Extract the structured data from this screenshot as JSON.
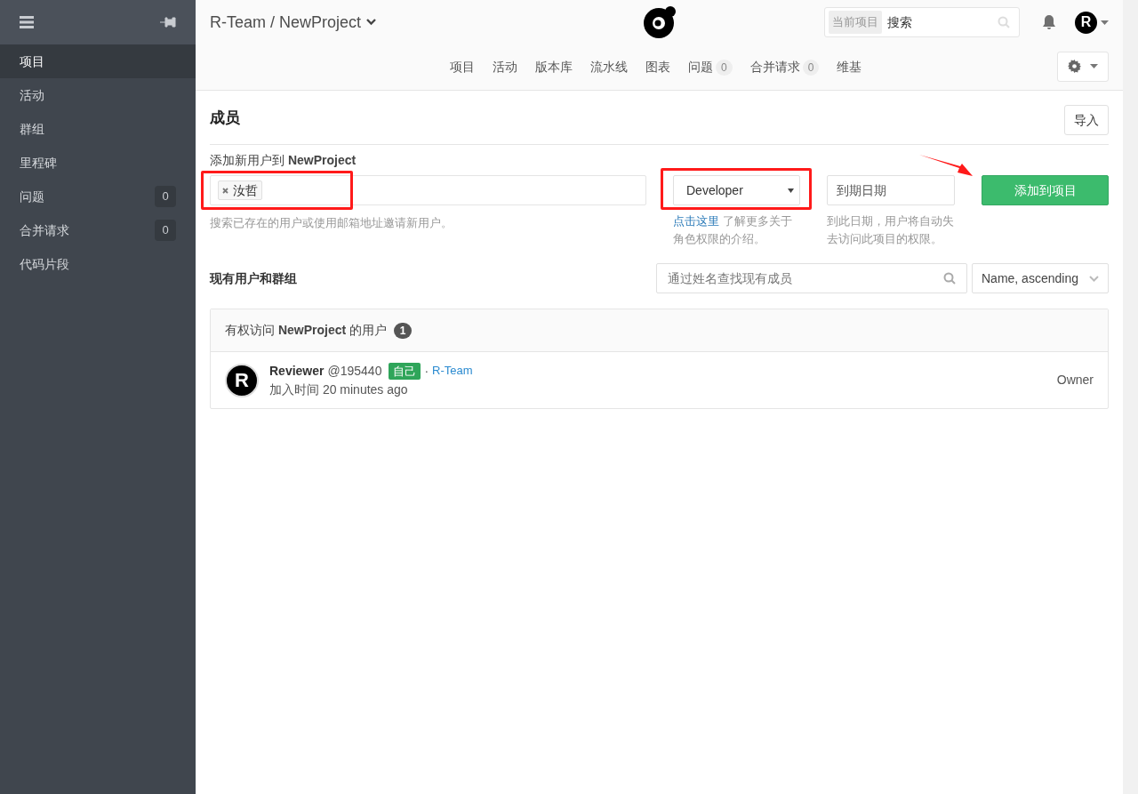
{
  "sidebar": {
    "items": [
      {
        "label": "项目",
        "selected": true
      },
      {
        "label": "活动",
        "selected": false
      },
      {
        "label": "群组",
        "selected": false
      },
      {
        "label": "里程碑",
        "selected": false
      },
      {
        "label": "问题",
        "selected": false,
        "count": "0"
      },
      {
        "label": "合并请求",
        "selected": false,
        "count": "0"
      },
      {
        "label": "代码片段",
        "selected": false
      }
    ]
  },
  "header": {
    "breadcrumb": "R-Team / NewProject",
    "search_scope": "当前项目",
    "search_placeholder": "搜索",
    "avatar_letter": "R"
  },
  "nav": [
    {
      "label": "项目"
    },
    {
      "label": "活动"
    },
    {
      "label": "版本库"
    },
    {
      "label": "流水线"
    },
    {
      "label": "图表"
    },
    {
      "label": "问题",
      "count": "0"
    },
    {
      "label": "合并请求",
      "count": "0"
    },
    {
      "label": "维基"
    }
  ],
  "page": {
    "title": "成员",
    "import_button": "导入"
  },
  "add_form": {
    "label": "添加新用户到 **NewProject**",
    "tokens": [
      "汝哲"
    ],
    "users_hint": "搜索已存在的用户或使用邮箱地址邀请新用户。",
    "role": "Developer",
    "role_link": "点击这里",
    "role_hint": " 了解更多关于角色权限的介绍。",
    "date_placeholder": "到期日期",
    "date_hint": "到此日期，用户将自动失去访问此项目的权限。",
    "submit": "添加到项目"
  },
  "existing": {
    "title": "现有用户和群组",
    "search_placeholder": "通过姓名查找现有成员",
    "sort": "Name, ascending"
  },
  "members_panel": {
    "title": "有权访问 **NewProject** 的用户",
    "count": "1",
    "members": [
      {
        "avatar_letter": "R",
        "name": "Reviewer",
        "username": "@195440",
        "badge": "自己",
        "separator": "·",
        "group": "R-Team",
        "joined": "加入时间 20 minutes ago",
        "role": "Owner"
      }
    ]
  },
  "annotations": [
    {
      "kind": "box"
    },
    {
      "kind": "box"
    },
    {
      "kind": "arrow"
    }
  ]
}
